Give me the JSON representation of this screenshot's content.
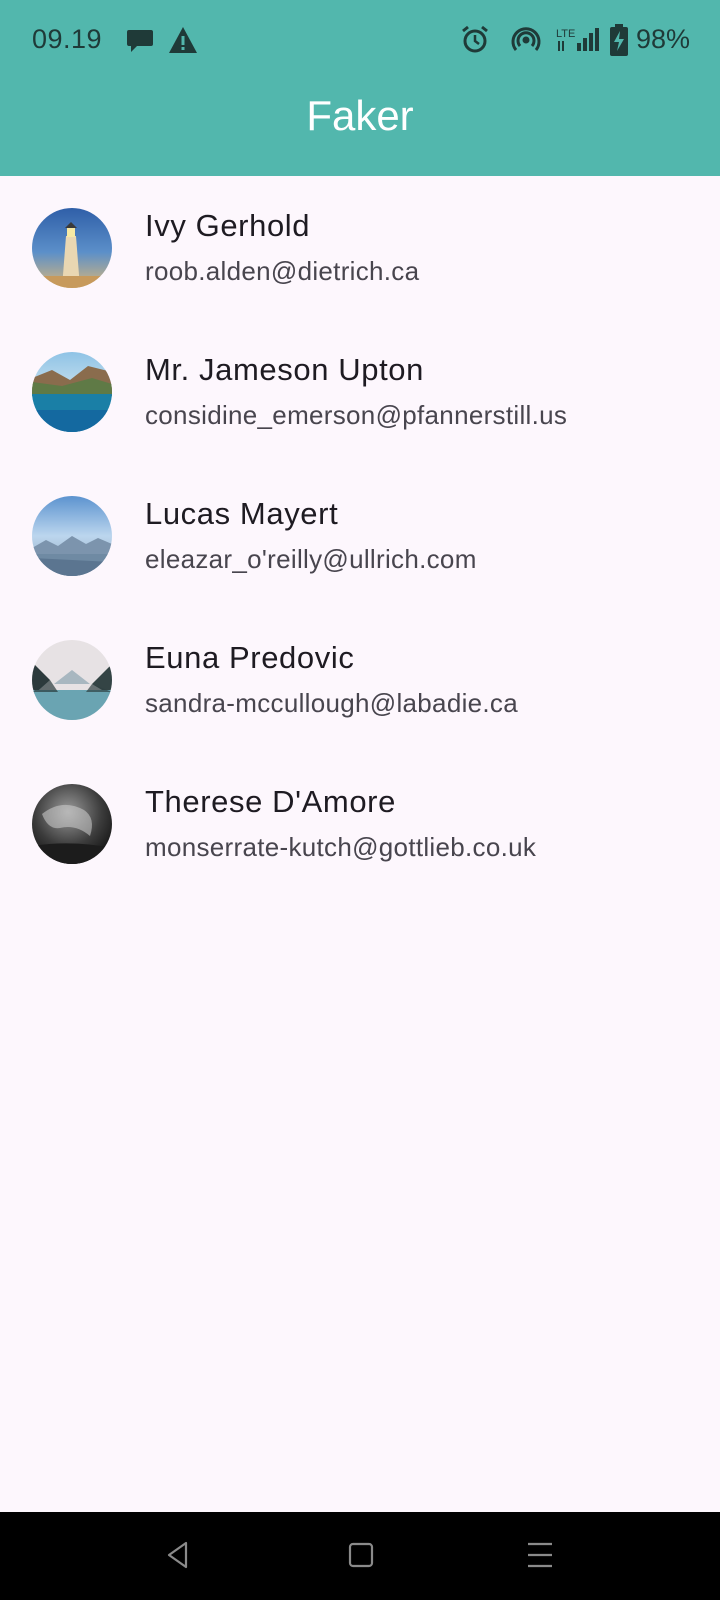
{
  "status_bar": {
    "time": "09.19",
    "battery_text": "98%",
    "left_icons": [
      "chat-bubble-icon",
      "warning-icon"
    ],
    "right_icons": [
      "alarm-icon",
      "hotspot-icon",
      "lte-signal-icon",
      "battery-charging-icon"
    ],
    "network_label": "LTE"
  },
  "app_bar": {
    "title": "Faker",
    "color": "#52b7ad"
  },
  "contacts": [
    {
      "name": "Ivy Gerhold",
      "email": "roob.alden@dietrich.ca",
      "avatar": "lighthouse-photo"
    },
    {
      "name": "Mr. Jameson Upton",
      "email": "considine_emerson@pfannerstill.us",
      "avatar": "coastal-cliff-photo"
    },
    {
      "name": "Lucas Mayert",
      "email": "eleazar_o'reilly@ullrich.com",
      "avatar": "misty-mountains-photo"
    },
    {
      "name": "Euna Predovic",
      "email": "sandra-mccullough@labadie.ca",
      "avatar": "mountain-lake-photo"
    },
    {
      "name": "Therese D'Amore",
      "email": "monserrate-kutch@gottlieb.co.uk",
      "avatar": "grayscale-photo"
    }
  ],
  "nav_bar": {
    "buttons": [
      "back-icon",
      "home-icon",
      "menu-icon"
    ]
  }
}
